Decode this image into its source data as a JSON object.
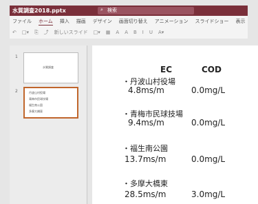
{
  "window": {
    "title": "水質調査2018.pptx",
    "search_text": "検索"
  },
  "menu": [
    "ファイル",
    "ホーム",
    "挿入",
    "描画",
    "デザイン",
    "画面切り替え",
    "アニメーション",
    "スライドショー",
    "表示"
  ],
  "menu_active": "ホーム",
  "toolbar": [
    "↶",
    "□▾",
    "⎘",
    "⤴",
    "新しいスライド",
    "□▾",
    "▦",
    "A",
    "A",
    "B",
    "I",
    "U",
    "A▾"
  ],
  "thumbnails": [
    {
      "number": "1",
      "title": "水質調査"
    },
    {
      "number": "2",
      "lines": [
        "丹波山村役場",
        "青梅市民球技場",
        "福生南公園",
        "多摩大橋東"
      ]
    }
  ],
  "slide": {
    "header_ec": "EC",
    "header_cod": "COD",
    "rows": [
      {
        "site": "・丹波山村役場",
        "ec": "4.8ms/m",
        "cod": "0.0mg/L"
      },
      {
        "site": "・青梅市民球技場",
        "ec": "9.4ms/m",
        "cod": "0.0mg/L"
      },
      {
        "site": "・福生南公園",
        "ec": "13.7ms/m",
        "cod": "0.0mg/L"
      },
      {
        "site": "・多摩大橋東",
        "ec": "28.5ms/m",
        "cod": "3.0mg/L"
      }
    ]
  }
}
